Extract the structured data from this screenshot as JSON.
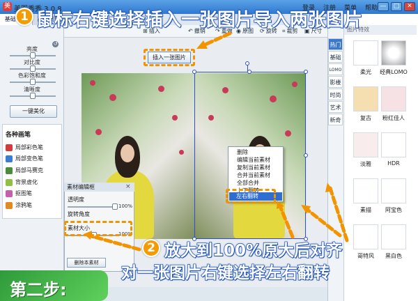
{
  "window": {
    "app_icon": "美",
    "title": "美图秀秀 3.0.8",
    "menu": [
      "登录",
      "注册",
      "菜单",
      "帮助"
    ],
    "buttons": [
      "—",
      "□",
      "✕"
    ]
  },
  "left_panel": {
    "tabs": [
      "基础调整",
      "高级调整"
    ],
    "adjustments": [
      {
        "label": "亮度",
        "value": 0.5
      },
      {
        "label": "对比度",
        "value": 0.5
      },
      {
        "label": "色彩饱和度",
        "value": 0.5
      },
      {
        "label": "清晰度",
        "value": 0.5
      }
    ],
    "one_click_button": "一键美化",
    "brush_title": "各种画笔",
    "brushes": [
      "局部彩色笔",
      "局部变色笔",
      "局部马赛克",
      "背景虚化",
      "抠图笔",
      "涂鸦笔"
    ]
  },
  "toolbar": {
    "items": [
      "插入",
      "撤销",
      "重做",
      "原图",
      "旋转",
      "裁剪",
      "尺寸"
    ]
  },
  "insert_button": "插入一张图片",
  "context_menu": {
    "items": [
      "删除",
      "编辑当前素材",
      "复制当前素材",
      "合并当前素材",
      "全部合并",
      "上下翻转"
    ],
    "highlight": "左右翻转"
  },
  "material_editor": {
    "title": "素材编辑框",
    "close": "×",
    "transparency_label": "透明度",
    "transparency_value": "100%",
    "rotation_label": "旋转角度",
    "size_label": "素材大小",
    "size_value": "100%",
    "delete_button": "删除本素材"
  },
  "right_panel": {
    "categories": [
      "热门",
      "基础",
      "LOMO",
      "影楼",
      "时尚",
      "艺术",
      "新奇"
    ],
    "header": "图片特效",
    "effects": [
      {
        "label": "柔光",
        "color": "#ffffff"
      },
      {
        "label": "经典LOMO",
        "color": "#c9c9c9"
      },
      {
        "label": "复古",
        "color": "#f5dfb0"
      },
      {
        "label": "粉红佳人",
        "color": "#f6e2e4"
      },
      {
        "label": "淡雅",
        "color": "#f9ecec"
      },
      {
        "label": "HDR",
        "color": "#ffffff"
      },
      {
        "label": "素描",
        "color": "#ffffff"
      },
      {
        "label": "阿宝色",
        "color": "#ffffff"
      },
      {
        "label": "哥特风",
        "color": "#ffffff"
      },
      {
        "label": "黑白色",
        "color": "#ffffff"
      }
    ]
  },
  "overlays": {
    "step1_number": "1",
    "step1_text": "鼠标右键选择插入一张图片导入两张图片",
    "step2_number": "2",
    "step2_line1": "放大到100%原大后对齐",
    "step2_line2": "对一张图片右键选择左右翻转",
    "step_label": "第二步:",
    "accent_color": "#f29300",
    "banner_color": "#1a4fb8"
  }
}
